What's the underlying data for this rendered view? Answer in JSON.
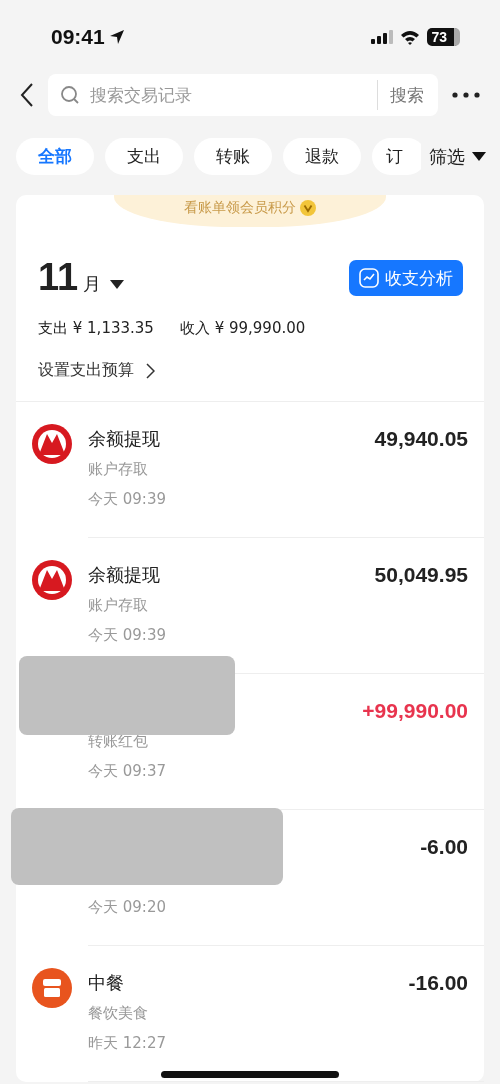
{
  "status_bar": {
    "time": "09:41",
    "battery": "73"
  },
  "search": {
    "placeholder": "搜索交易记录",
    "button": "搜索"
  },
  "filter_tabs": [
    {
      "label": "全部",
      "selected": true
    },
    {
      "label": "支出",
      "selected": false
    },
    {
      "label": "转账",
      "selected": false
    },
    {
      "label": "退款",
      "selected": false
    },
    {
      "label": "订",
      "selected": false
    }
  ],
  "filter_button": "筛选",
  "banner": "看账单领会员积分",
  "summary": {
    "month": "11",
    "month_unit": "月",
    "analysis_button": "收支分析",
    "expense": "支出 ¥ 1,133.35",
    "income": "收入 ¥ 99,990.00",
    "budget_link": "设置支出预算"
  },
  "transactions": [
    {
      "kind": "bank",
      "title": "余额提现",
      "category": "账户存取",
      "time": "今天 09:39",
      "amount": "49,940.05",
      "income": false
    },
    {
      "kind": "bank",
      "title": "余额提现",
      "category": "账户存取",
      "time": "今天 09:39",
      "amount": "50,049.95",
      "income": false
    },
    {
      "kind": "hidden",
      "category": "转账红包",
      "time": "今天 09:37",
      "amount": "+99,990.00",
      "income": true,
      "redacted": true
    },
    {
      "kind": "hidden",
      "time": "今天 09:20",
      "amount": "-6.00",
      "income": false,
      "redacted": true
    },
    {
      "kind": "shop",
      "title": "中餐",
      "category": "餐饮美食",
      "time": "昨天 12:27",
      "amount": "-16.00",
      "income": false
    }
  ]
}
